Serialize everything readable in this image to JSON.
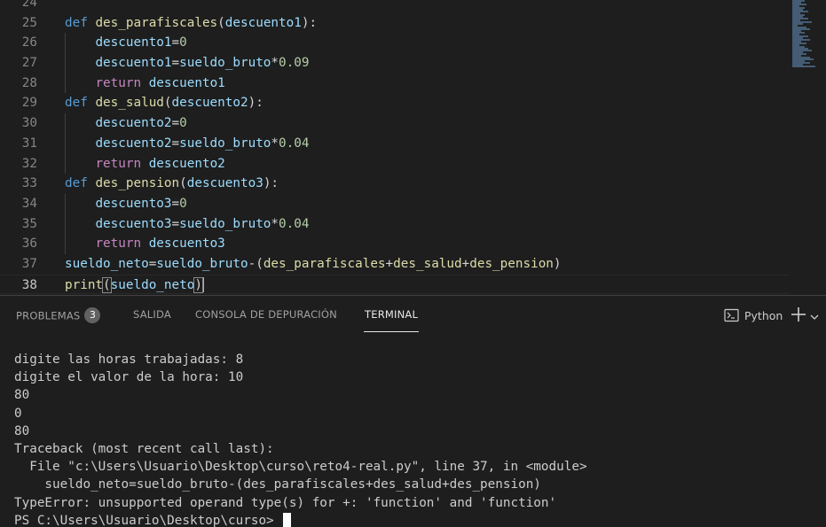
{
  "editor": {
    "lines": [
      {
        "n": "24",
        "tokens": []
      },
      {
        "n": "25",
        "tokens": [
          [
            "kw",
            "def"
          ],
          [
            "op",
            " "
          ],
          [
            "fn",
            "des_parafiscales"
          ],
          [
            "op",
            "("
          ],
          [
            "var",
            "descuento1"
          ],
          [
            "op",
            "):"
          ]
        ]
      },
      {
        "n": "26",
        "tokens": [
          [
            "op",
            "    "
          ],
          [
            "var",
            "descuento1"
          ],
          [
            "op",
            "="
          ],
          [
            "num",
            "0"
          ]
        ]
      },
      {
        "n": "27",
        "tokens": [
          [
            "op",
            "    "
          ],
          [
            "var",
            "descuento1"
          ],
          [
            "op",
            "="
          ],
          [
            "var",
            "sueldo_bruto"
          ],
          [
            "op",
            "*"
          ],
          [
            "num",
            "0.09"
          ]
        ]
      },
      {
        "n": "28",
        "tokens": [
          [
            "op",
            "    "
          ],
          [
            "ctl",
            "return"
          ],
          [
            "op",
            " "
          ],
          [
            "var",
            "descuento1"
          ]
        ]
      },
      {
        "n": "29",
        "tokens": [
          [
            "kw",
            "def"
          ],
          [
            "op",
            " "
          ],
          [
            "fn",
            "des_salud"
          ],
          [
            "op",
            "("
          ],
          [
            "var",
            "descuento2"
          ],
          [
            "op",
            "):"
          ]
        ]
      },
      {
        "n": "30",
        "tokens": [
          [
            "op",
            "    "
          ],
          [
            "var",
            "descuento2"
          ],
          [
            "op",
            "="
          ],
          [
            "num",
            "0"
          ]
        ]
      },
      {
        "n": "31",
        "tokens": [
          [
            "op",
            "    "
          ],
          [
            "var",
            "descuento2"
          ],
          [
            "op",
            "="
          ],
          [
            "var",
            "sueldo_bruto"
          ],
          [
            "op",
            "*"
          ],
          [
            "num",
            "0.04"
          ]
        ]
      },
      {
        "n": "32",
        "tokens": [
          [
            "op",
            "    "
          ],
          [
            "ctl",
            "return"
          ],
          [
            "op",
            " "
          ],
          [
            "var",
            "descuento2"
          ]
        ]
      },
      {
        "n": "33",
        "tokens": [
          [
            "kw",
            "def"
          ],
          [
            "op",
            " "
          ],
          [
            "fn",
            "des_pension"
          ],
          [
            "op",
            "("
          ],
          [
            "var",
            "descuento3"
          ],
          [
            "op",
            "):"
          ]
        ]
      },
      {
        "n": "34",
        "tokens": [
          [
            "op",
            "    "
          ],
          [
            "var",
            "descuento3"
          ],
          [
            "op",
            "="
          ],
          [
            "num",
            "0"
          ]
        ]
      },
      {
        "n": "35",
        "tokens": [
          [
            "op",
            "    "
          ],
          [
            "var",
            "descuento3"
          ],
          [
            "op",
            "="
          ],
          [
            "var",
            "sueldo_bruto"
          ],
          [
            "op",
            "*"
          ],
          [
            "num",
            "0.04"
          ]
        ]
      },
      {
        "n": "36",
        "tokens": [
          [
            "op",
            "    "
          ],
          [
            "ctl",
            "return"
          ],
          [
            "op",
            " "
          ],
          [
            "var",
            "descuento3"
          ]
        ]
      },
      {
        "n": "37",
        "tokens": [
          [
            "var",
            "sueldo_neto"
          ],
          [
            "op",
            "="
          ],
          [
            "var",
            "sueldo_bruto"
          ],
          [
            "op",
            "-("
          ],
          [
            "fn",
            "des_parafiscales"
          ],
          [
            "op",
            "+"
          ],
          [
            "fn",
            "des_salud"
          ],
          [
            "op",
            "+"
          ],
          [
            "fn",
            "des_pension"
          ],
          [
            "op",
            ")"
          ]
        ]
      },
      {
        "n": "38",
        "tokens": [
          [
            "fn",
            "print"
          ],
          [
            "bracket",
            "("
          ],
          [
            "var",
            "sueldo_neto"
          ],
          [
            "bracket",
            ")"
          ],
          [
            "cursor",
            ""
          ]
        ],
        "current": true
      }
    ]
  },
  "panel": {
    "tabs": [
      {
        "label": "PROBLEMAS",
        "badge": "3"
      },
      {
        "label": "SALIDA"
      },
      {
        "label": "CONSOLA DE DEPURACIÓN"
      },
      {
        "label": "TERMINAL",
        "active": true
      }
    ],
    "shell_label": "Python",
    "icons": {
      "shell": "terminal-icon",
      "new": "plus-icon",
      "more": "chevron-down-icon"
    }
  },
  "terminal": {
    "lines": [
      "digite las horas trabajadas: 8",
      "digite el valor de la hora: 10",
      "80",
      "0",
      "80",
      "Traceback (most recent call last):",
      "  File \"c:\\Users\\Usuario\\Desktop\\curso\\reto4-real.py\", line 37, in <module>",
      "    sueldo_neto=sueldo_bruto-(des_parafiscales+des_salud+des_pension)",
      "TypeError: unsupported operand type(s) for +: 'function' and 'function'"
    ],
    "prompt": "PS C:\\Users\\Usuario\\Desktop\\curso> "
  },
  "colors": {
    "background": "#1e1e1e",
    "keyword": "#569cd6",
    "control": "#c586c0",
    "function": "#dcdcaa",
    "variable": "#9cdcfe",
    "number": "#b5cea8"
  }
}
